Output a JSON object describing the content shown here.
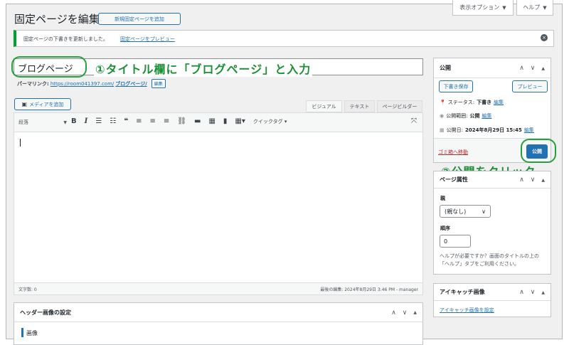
{
  "header": {
    "title": "固定ページを編集",
    "add_new_label": "新規固定ページを追加",
    "screen_options_label": "表示オプション",
    "help_label": "ヘルプ"
  },
  "notice": {
    "text": "固定ページの下書きを更新しました。",
    "preview_link": "固定ページをプレビュー"
  },
  "editor": {
    "title_value": "ブログページ",
    "permalink_label": "パーマリンク:",
    "permalink_base": "https://room041397.com/",
    "permalink_slug": "ブログページ/",
    "permalink_edit": "編集",
    "media_button": "メディアを追加",
    "tabs": [
      "ビジュアル",
      "テキスト",
      "ページビルダー"
    ],
    "format_select": "段落",
    "quicktag_label": "クイックタグ",
    "word_count": "文字数: 0",
    "last_edited": "最後の編集: 2024年8月29日 3:46 PM - manager"
  },
  "annotations": {
    "step1": "①タイトル欄に「ブログページ」と入力",
    "step2": "②公開をクリック"
  },
  "publish_box": {
    "title": "公開",
    "save_draft": "下書き保存",
    "preview": "プレビュー",
    "status_label": "ステータス:",
    "status_value": "下書き",
    "status_edit": "編集",
    "visibility_label": "公開範囲:",
    "visibility_value": "公開",
    "visibility_edit": "編集",
    "date_label": "公開日:",
    "date_value": "2024年8月29日 15:45",
    "date_edit": "編集",
    "trash_link": "ゴミ箱へ移動",
    "publish_button": "公開"
  },
  "page_attributes": {
    "title": "ページ属性",
    "parent_label": "親",
    "parent_value": "(親なし)",
    "order_label": "順序",
    "order_value": "0",
    "help_text": "ヘルプが必要ですか？画面のタイトルの上の「ヘルプ」タブをご利用ください。"
  },
  "featured_image": {
    "title": "アイキャッチ画像",
    "set_link": "アイキャッチ画像を設定"
  },
  "header_image_box": {
    "title": "ヘッダー画像の設定",
    "sub_label": "画像"
  },
  "colors": {
    "accent": "#2271b1",
    "annotation_green": "#27a03c",
    "trash_red": "#b32d2e"
  }
}
